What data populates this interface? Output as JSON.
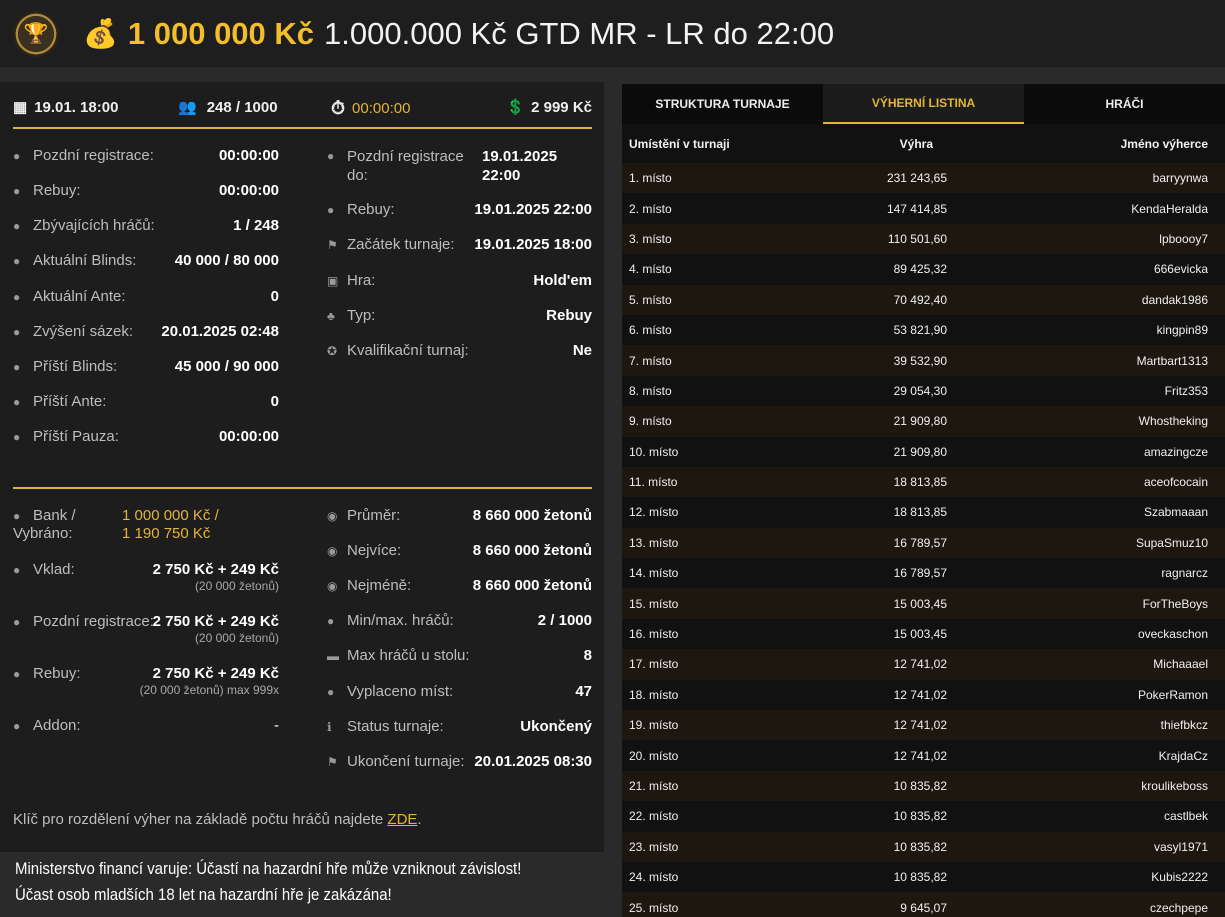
{
  "header": {
    "prize": "1 000 000 Kč",
    "title": "1.000.000 Kč GTD MR - LR do 22:00"
  },
  "topbar": {
    "date": "19.01. 18:00",
    "players": "248 / 1000",
    "timer": "00:00:00",
    "buyin": "2 999 Kč"
  },
  "info_left": [
    {
      "label": "Pozdní registrace:",
      "value": "00:00:00"
    },
    {
      "label": "Rebuy:",
      "value": "00:00:00"
    },
    {
      "label": "Zbývajících hráčů:",
      "value": "1 / 248"
    },
    {
      "label": "Aktuální Blinds:",
      "value": "40 000 / 80 000"
    },
    {
      "label": "Aktuální Ante:",
      "value": "0"
    },
    {
      "label": "Zvýšení sázek:",
      "value": "20.01.2025 02:48"
    },
    {
      "label": "Příští Blinds:",
      "value": "45 000 / 90 000"
    },
    {
      "label": "Příští Ante:",
      "value": "0"
    },
    {
      "label": "Příští Pauza:",
      "value": "00:00:00"
    }
  ],
  "info_right": {
    "late_reg_label_1": "Pozdní registrace",
    "late_reg_label_2": "do:",
    "late_reg_value_1": "19.01.2025",
    "late_reg_value_2": "22:00",
    "items": [
      {
        "label": "Rebuy:",
        "value": "19.01.2025 22:00"
      },
      {
        "label": "Začátek turnaje:",
        "value": "19.01.2025 18:00"
      },
      {
        "label": "Hra:",
        "value": "Hold'em"
      },
      {
        "label": "Typ:",
        "value": "Rebuy"
      },
      {
        "label": "Kvalifikační turnaj:",
        "value": "Ne"
      }
    ]
  },
  "finance_left": {
    "bank_label_1": "Bank /",
    "bank_label_2": "Vybráno:",
    "bank_value_1": "1 000 000 Kč /",
    "bank_value_2": "1 190 750 Kč",
    "deposit_label": "Vklad:",
    "deposit_value": "2 750 Kč + 249 Kč",
    "deposit_sub": "(20 000 žetonů)",
    "latereg_label": "Pozdní registrace:",
    "latereg_value": "2 750 Kč + 249 Kč",
    "latereg_sub": "(20 000 žetonů)",
    "rebuy_label": "Rebuy:",
    "rebuy_value": "2 750 Kč + 249 Kč",
    "rebuy_sub": "(20 000 žetonů) max 999x",
    "addon_label": "Addon:",
    "addon_value": "-"
  },
  "finance_right": [
    {
      "label": "Průměr:",
      "value": "8 660 000 žetonů"
    },
    {
      "label": "Nejvíce:",
      "value": "8 660 000 žetonů"
    },
    {
      "label": "Nejméně:",
      "value": "8 660 000 žetonů"
    },
    {
      "label": "Min/max. hráčů:",
      "value": "2 / 1000"
    },
    {
      "label": "Max hráčů u stolu:",
      "value": "8"
    },
    {
      "label": "Vyplaceno míst:",
      "value": "47"
    },
    {
      "label": "Status turnaje:",
      "value": "Ukončený"
    },
    {
      "label": "Ukončení turnaje:",
      "value": "20.01.2025 08:30"
    }
  ],
  "note": {
    "text": "Klíč pro rozdělení výher na základě počtu hráčů najdete ",
    "link": "ZDE",
    "end": "."
  },
  "warning": {
    "line1": "Ministerstvo financí varuje: Účastí na hazardní hře může vzniknout závislost!",
    "line2": "Účast osob mladších 18 let na hazardní hře je zakázána!"
  },
  "tabs": [
    "STRUKTURA TURNAJE",
    "VÝHERNÍ LISTINA",
    "HRÁČI"
  ],
  "table": {
    "headers": [
      "Umístění v turnaji",
      "Výhra",
      "Jméno výherce"
    ],
    "rows": [
      [
        "1. místo",
        "231 243,65",
        "barryynwa"
      ],
      [
        "2. místo",
        "147 414,85",
        "KendaHeralda"
      ],
      [
        "3. místo",
        "110 501,60",
        "lpboooy7"
      ],
      [
        "4. místo",
        "89 425,32",
        "666evicka"
      ],
      [
        "5. místo",
        "70 492,40",
        "dandak1986"
      ],
      [
        "6. místo",
        "53 821,90",
        "kingpin89"
      ],
      [
        "7. místo",
        "39 532,90",
        "Martbart1313"
      ],
      [
        "8. místo",
        "29 054,30",
        "Fritz353"
      ],
      [
        "9. místo",
        "21 909,80",
        "Whostheking"
      ],
      [
        "10. místo",
        "21 909,80",
        "amazingcze"
      ],
      [
        "11. místo",
        "18 813,85",
        "aceofcocain"
      ],
      [
        "12. místo",
        "18 813,85",
        "Szabmaaan"
      ],
      [
        "13. místo",
        "16 789,57",
        "SupaSmuz10"
      ],
      [
        "14. místo",
        "16 789,57",
        "ragnarcz"
      ],
      [
        "15. místo",
        "15 003,45",
        "ForTheBoys"
      ],
      [
        "16. místo",
        "15 003,45",
        "oveckaschon"
      ],
      [
        "17. místo",
        "12 741,02",
        "Michaaael"
      ],
      [
        "18. místo",
        "12 741,02",
        "PokerRamon"
      ],
      [
        "19. místo",
        "12 741,02",
        "thiefbkcz"
      ],
      [
        "20. místo",
        "12 741,02",
        "KrajdaCz"
      ],
      [
        "21. místo",
        "10 835,82",
        "kroulikeboss"
      ],
      [
        "22. místo",
        "10 835,82",
        "castlbek"
      ],
      [
        "23. místo",
        "10 835,82",
        "vasyl1971"
      ],
      [
        "24. místo",
        "10 835,82",
        "Kubis2222"
      ],
      [
        "25. místo",
        "9 645,07",
        "czechpepe"
      ]
    ]
  }
}
